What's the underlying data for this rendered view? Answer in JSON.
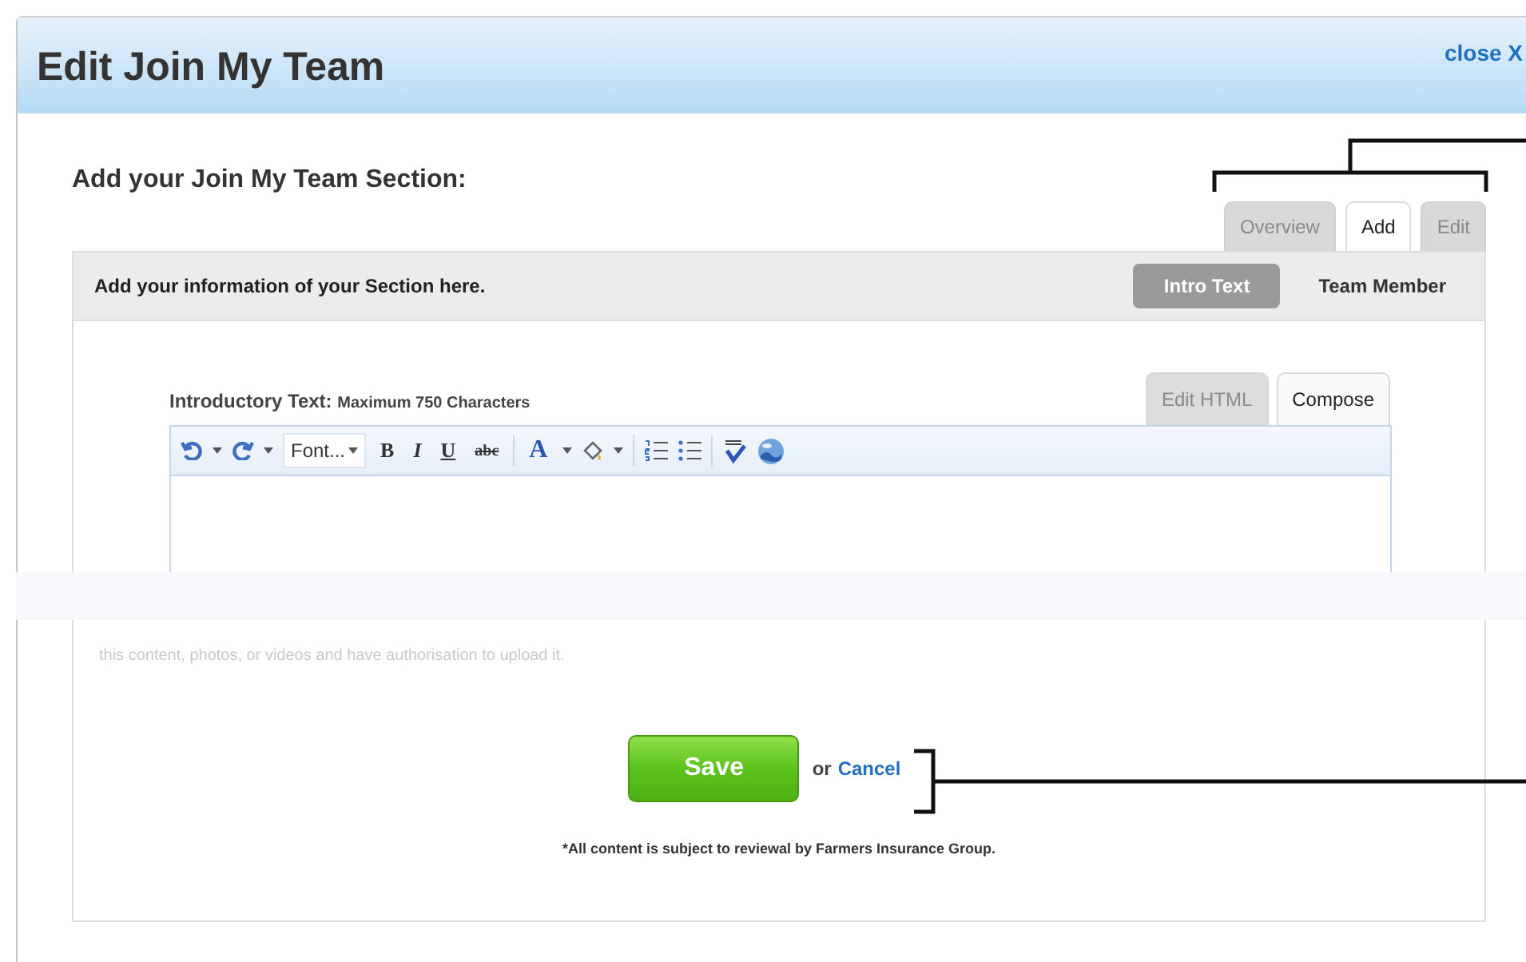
{
  "window": {
    "title": "Edit Join My Team",
    "close": "close X"
  },
  "heading": "Add your Join My Team Section:",
  "section_tabs": [
    {
      "label": "Overview",
      "selected": false
    },
    {
      "label": "Add",
      "selected": true
    },
    {
      "label": "Edit",
      "selected": false
    }
  ],
  "panel": {
    "title": "Add your information of your Section here.",
    "toggles": [
      {
        "label": "Intro Text",
        "selected": true
      },
      {
        "label": "Team Member",
        "selected": false
      }
    ]
  },
  "editor": {
    "label": "Introductory Text:",
    "hint": "Maximum 750 Characters",
    "mode_tabs": [
      {
        "label": "Edit HTML",
        "selected": false
      },
      {
        "label": "Compose",
        "selected": true
      }
    ],
    "toolbar": {
      "font": "Font...",
      "bold": "B",
      "italic": "I",
      "underline": "U",
      "strike": "abc",
      "font_color": "A"
    }
  },
  "notice": "this content, photos, or videos and have authorisation to upload it.",
  "actions": {
    "save": "Save",
    "or": "or",
    "cancel": "Cancel"
  },
  "footnote": "*All content is subject to reviewal by Farmers Insurance Group."
}
